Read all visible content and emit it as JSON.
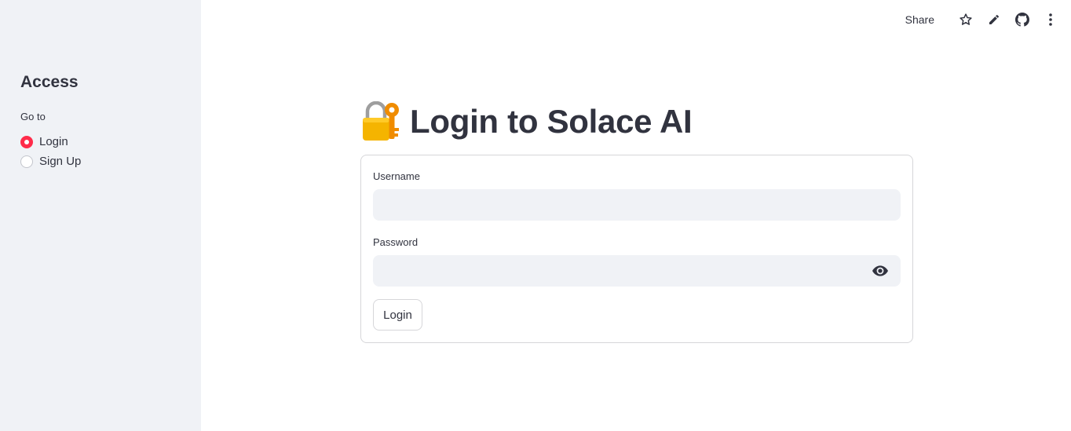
{
  "sidebar": {
    "title": "Access",
    "nav_label": "Go to",
    "options": [
      {
        "label": "Login",
        "selected": true
      },
      {
        "label": "Sign Up",
        "selected": false
      }
    ]
  },
  "toolbar": {
    "share_label": "Share",
    "icons": [
      "star-icon",
      "edit-icon",
      "github-icon",
      "more-vertical-icon"
    ]
  },
  "main": {
    "title_icon": "locked-with-key-icon",
    "title": "Login to Solace AI",
    "form": {
      "username_label": "Username",
      "username_value": "",
      "password_label": "Password",
      "password_value": "",
      "submit_label": "Login"
    }
  },
  "colors": {
    "accent": "#ff2b4a",
    "sidebar_bg": "#f0f2f6",
    "input_bg": "#f0f2f6",
    "text": "#31333f",
    "lock_body": "#f5b400",
    "key": "#f08c00"
  }
}
